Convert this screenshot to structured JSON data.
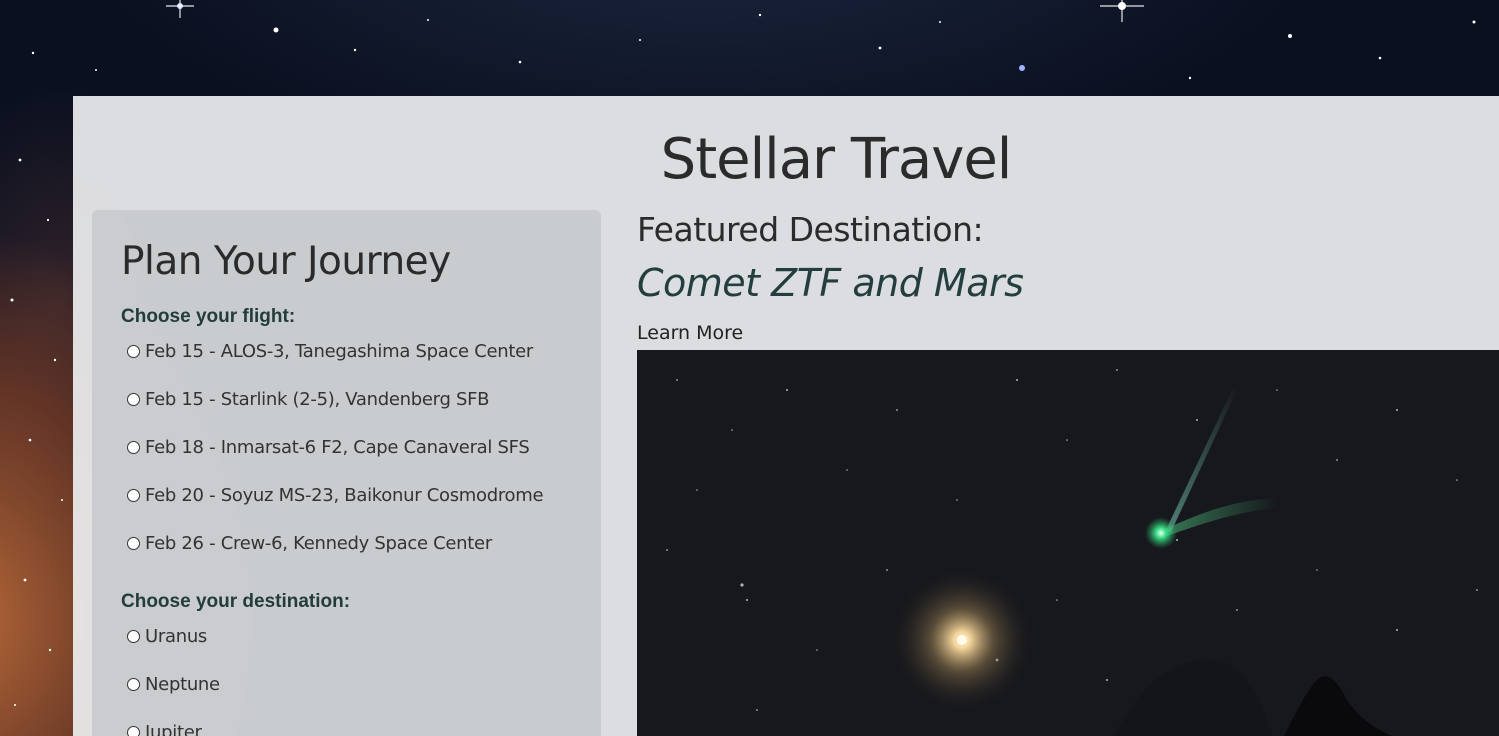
{
  "header": {
    "title": "Stellar Travel"
  },
  "plan": {
    "title": "Plan Your Journey",
    "flight_label": "Choose your flight:",
    "flights": [
      "Feb 15 - ALOS-3, Tanegashima Space Center",
      "Feb 15 - Starlink (2-5), Vandenberg SFB",
      "Feb 18 - Inmarsat-6 F2, Cape Canaveral SFS",
      "Feb 20 - Soyuz MS-23, Baikonur Cosmodrome",
      "Feb 26 - Crew-6, Kennedy Space Center"
    ],
    "destination_label": "Choose your destination:",
    "destinations": [
      "Uranus",
      "Neptune",
      "Jupiter"
    ]
  },
  "featured": {
    "heading": "Featured Destination:",
    "name": "Comet ZTF and Mars",
    "link": "Learn More"
  },
  "colors": {
    "accent_text": "#243e3f",
    "label_text": "#233c3c",
    "card_background": "#ecedef",
    "panel_background": "#c4c6ca"
  }
}
